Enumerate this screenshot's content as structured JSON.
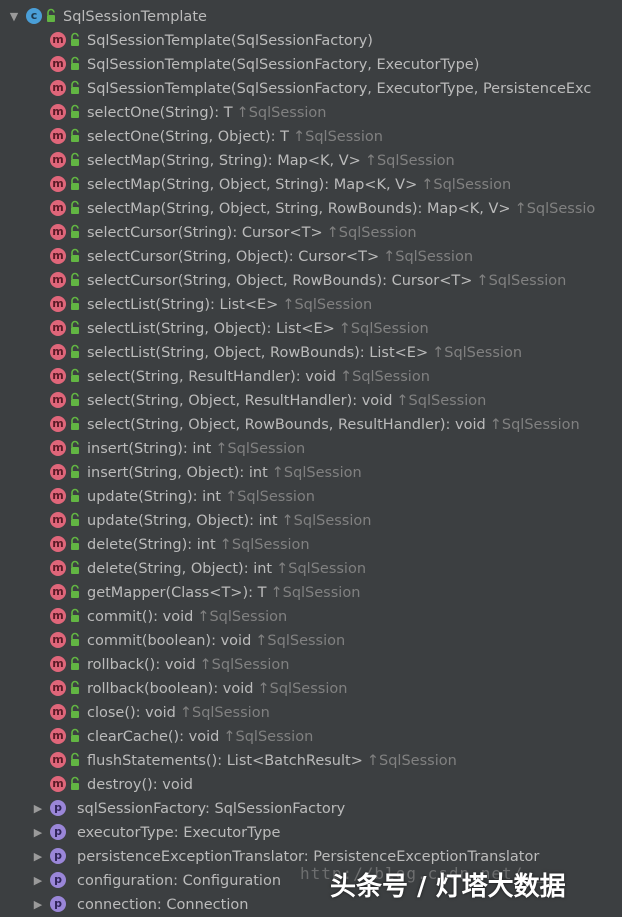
{
  "root": {
    "label": "SqlSessionTemplate",
    "icon": "class-icon",
    "badge": "c"
  },
  "methods": [
    {
      "text": "SqlSessionTemplate(SqlSessionFactory)",
      "inherited": ""
    },
    {
      "text": "SqlSessionTemplate(SqlSessionFactory, ExecutorType)",
      "inherited": ""
    },
    {
      "text": "SqlSessionTemplate(SqlSessionFactory, ExecutorType, PersistenceExc",
      "inherited": ""
    },
    {
      "text": "selectOne(String): T",
      "inherited": "↑SqlSession"
    },
    {
      "text": "selectOne(String, Object): T",
      "inherited": "↑SqlSession"
    },
    {
      "text": "selectMap(String, String): Map<K, V>",
      "inherited": "↑SqlSession"
    },
    {
      "text": "selectMap(String, Object, String): Map<K, V>",
      "inherited": "↑SqlSession"
    },
    {
      "text": "selectMap(String, Object, String, RowBounds): Map<K, V>",
      "inherited": "↑SqlSessio"
    },
    {
      "text": "selectCursor(String): Cursor<T>",
      "inherited": "↑SqlSession"
    },
    {
      "text": "selectCursor(String, Object): Cursor<T>",
      "inherited": "↑SqlSession"
    },
    {
      "text": "selectCursor(String, Object, RowBounds): Cursor<T>",
      "inherited": "↑SqlSession"
    },
    {
      "text": "selectList(String): List<E>",
      "inherited": "↑SqlSession"
    },
    {
      "text": "selectList(String, Object): List<E>",
      "inherited": "↑SqlSession"
    },
    {
      "text": "selectList(String, Object, RowBounds): List<E>",
      "inherited": "↑SqlSession"
    },
    {
      "text": "select(String, ResultHandler): void",
      "inherited": "↑SqlSession"
    },
    {
      "text": "select(String, Object, ResultHandler): void",
      "inherited": "↑SqlSession"
    },
    {
      "text": "select(String, Object, RowBounds, ResultHandler): void",
      "inherited": "↑SqlSession"
    },
    {
      "text": "insert(String): int",
      "inherited": "↑SqlSession"
    },
    {
      "text": "insert(String, Object): int",
      "inherited": "↑SqlSession"
    },
    {
      "text": "update(String): int",
      "inherited": "↑SqlSession"
    },
    {
      "text": "update(String, Object): int",
      "inherited": "↑SqlSession"
    },
    {
      "text": "delete(String): int",
      "inherited": "↑SqlSession"
    },
    {
      "text": "delete(String, Object): int",
      "inherited": "↑SqlSession"
    },
    {
      "text": "getMapper(Class<T>): T",
      "inherited": "↑SqlSession"
    },
    {
      "text": "commit(): void",
      "inherited": "↑SqlSession"
    },
    {
      "text": "commit(boolean): void",
      "inherited": "↑SqlSession"
    },
    {
      "text": "rollback(): void",
      "inherited": "↑SqlSession"
    },
    {
      "text": "rollback(boolean): void",
      "inherited": "↑SqlSession"
    },
    {
      "text": "close(): void",
      "inherited": "↑SqlSession"
    },
    {
      "text": "clearCache(): void",
      "inherited": "↑SqlSession"
    },
    {
      "text": "flushStatements(): List<BatchResult>",
      "inherited": "↑SqlSession"
    },
    {
      "text": "destroy(): void",
      "inherited": ""
    }
  ],
  "fields": [
    {
      "text": "sqlSessionFactory: SqlSessionFactory"
    },
    {
      "text": "executorType: ExecutorType"
    },
    {
      "text": "persistenceExceptionTranslator: PersistenceExceptionTranslator"
    },
    {
      "text": "configuration: Configuration"
    },
    {
      "text": "connection: Connection"
    }
  ],
  "badges": {
    "method": "m",
    "property": "p"
  },
  "overlay": {
    "watermark": "http://blog.csdn.net/___",
    "brand": "头条号 / 灯塔大数据"
  },
  "colors": {
    "background": "#3c3f41",
    "text": "#bbbbbb",
    "inherited": "#808080",
    "class_badge": "#4a9fd8",
    "method_badge": "#e0667a",
    "property_badge": "#9a86d8",
    "lock": "#62b543"
  }
}
